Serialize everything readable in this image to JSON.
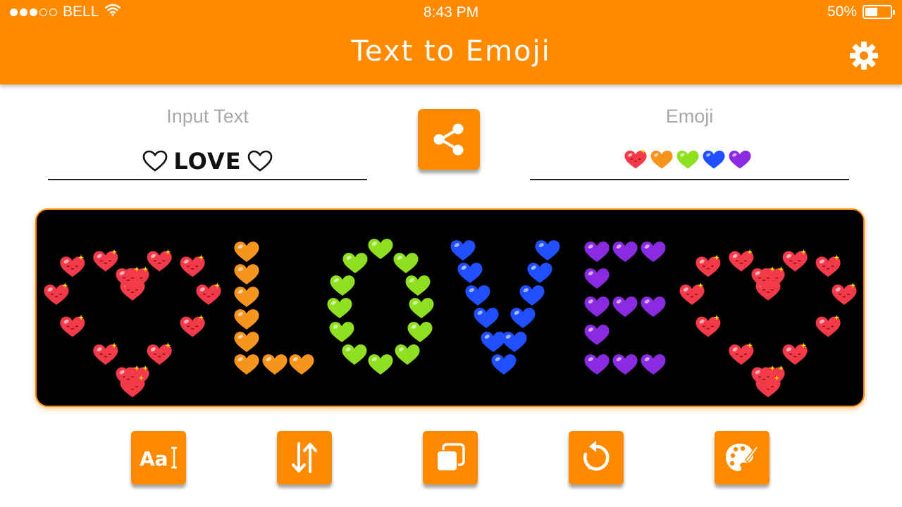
{
  "status_bar": {
    "carrier": "BELL",
    "signal_bars": 3,
    "signal_total": 5,
    "time": "8:43 PM",
    "battery_percent_label": "50%",
    "battery_level": 0.5
  },
  "header": {
    "title": "Text to Emoji",
    "settings_icon": "gear-icon"
  },
  "input": {
    "label": "Input Text",
    "value": "LOVE",
    "prefix_symbol": "outline-heart",
    "suffix_symbol": "outline-heart"
  },
  "share": {
    "icon": "share-icon"
  },
  "emoji": {
    "label": "Emoji",
    "hearts": [
      {
        "name": "red-heart-emoji",
        "color": "#f23a4a"
      },
      {
        "name": "orange-heart-emoji",
        "color": "#f7941d"
      },
      {
        "name": "green-heart-emoji",
        "color": "#8ee020"
      },
      {
        "name": "blue-heart-emoji",
        "color": "#1f4fff"
      },
      {
        "name": "purple-heart-emoji",
        "color": "#8a2be2"
      }
    ]
  },
  "preview": {
    "background": "#000000",
    "text": "♡LOVE♡",
    "letters": [
      {
        "char": "♡",
        "color": "#f23a4a"
      },
      {
        "char": "L",
        "color": "#f7941d"
      },
      {
        "char": "O",
        "color": "#8ee020"
      },
      {
        "char": "V",
        "color": "#1f4fff"
      },
      {
        "char": "E",
        "color": "#8a2be2"
      },
      {
        "char": "♡",
        "color": "#f23a4a"
      }
    ]
  },
  "toolbar": [
    {
      "name": "font-button",
      "icon": "font-icon"
    },
    {
      "name": "swap-button",
      "icon": "swap-vertical-icon"
    },
    {
      "name": "copy-button",
      "icon": "copy-icon"
    },
    {
      "name": "rotate-button",
      "icon": "rotate-icon"
    },
    {
      "name": "color-button",
      "icon": "palette-icon"
    }
  ],
  "colors": {
    "accent": "#ff8a00",
    "label_gray": "#a8a8a8"
  }
}
